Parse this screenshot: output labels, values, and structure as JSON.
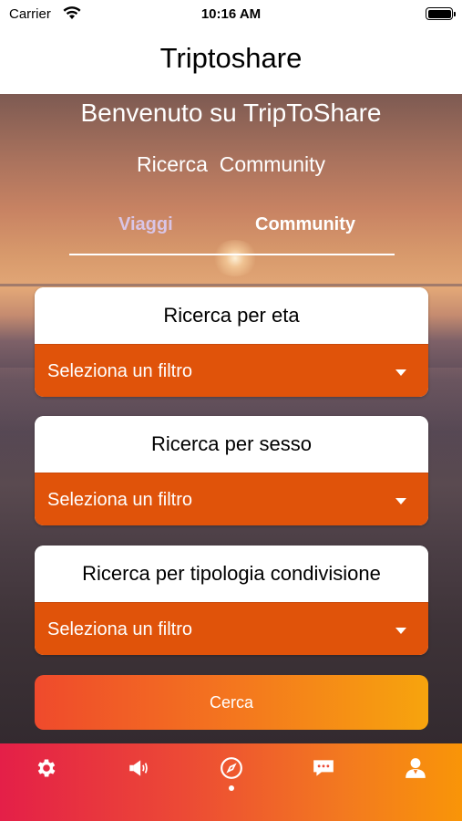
{
  "status_bar": {
    "carrier": "Carrier",
    "time": "10:16 AM",
    "wifi_icon": "wifi-icon",
    "battery_icon": "battery-icon"
  },
  "nav": {
    "title": "Triptoshare"
  },
  "hero": {
    "title": "Benvenuto su TripToShare",
    "subtitle": "Ricerca  Community"
  },
  "tabs": [
    {
      "label": "Viaggi",
      "active": false
    },
    {
      "label": "Community",
      "active": true
    }
  ],
  "filters": [
    {
      "title": "Ricerca per eta",
      "select_value": "Seleziona un filtro"
    },
    {
      "title": "Ricerca per sesso",
      "select_value": "Seleziona un filtro"
    },
    {
      "title": "Ricerca per tipologia condivisione",
      "select_value": "Seleziona un filtro"
    }
  ],
  "search_button": {
    "label": "Cerca"
  },
  "tabbar": {
    "items": [
      {
        "icon": "gear-icon"
      },
      {
        "icon": "megaphone-icon"
      },
      {
        "icon": "compass-icon",
        "active": true
      },
      {
        "icon": "chat-icon"
      },
      {
        "icon": "user-icon"
      }
    ]
  },
  "colors": {
    "select_bg": "#e0530a",
    "tab_inactive": "#d9c5e6",
    "tabbar_gradient_start": "#e41f48",
    "tabbar_gradient_end": "#f99508",
    "button_gradient_start": "#ef4a2c",
    "button_gradient_end": "#f7a40d"
  }
}
